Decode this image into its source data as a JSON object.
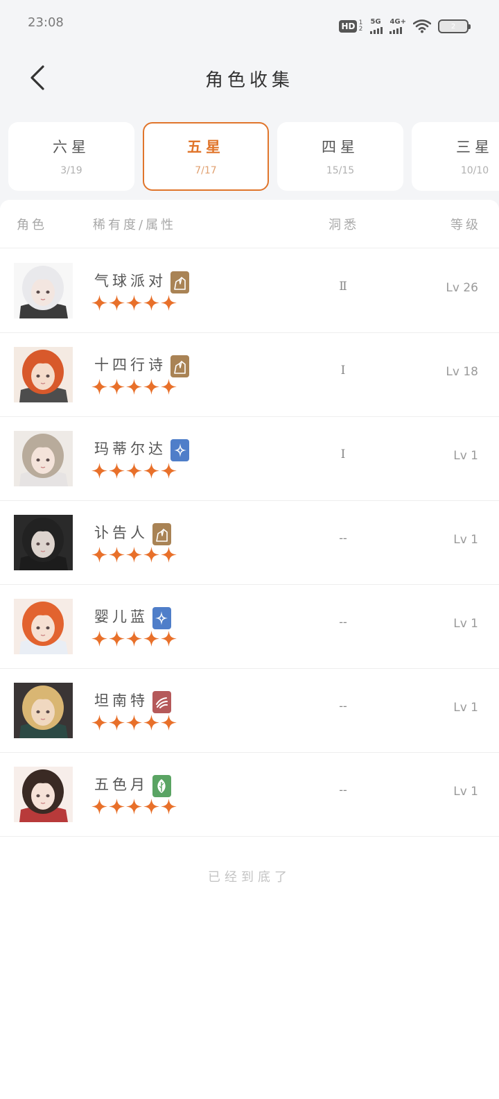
{
  "status_bar": {
    "time": "23:08",
    "hd": "HD",
    "hd_sub": "1 2",
    "signal1": "5G",
    "signal2": "4G+",
    "battery": "2"
  },
  "header": {
    "title": "角色收集"
  },
  "tabs": [
    {
      "label": "六星",
      "count": "3/19",
      "active": false
    },
    {
      "label": "五星",
      "count": "7/17",
      "active": true
    },
    {
      "label": "四星",
      "count": "15/15",
      "active": false
    },
    {
      "label": "三星",
      "count": "10/10",
      "active": false
    }
  ],
  "table": {
    "headers": {
      "character": "角色",
      "rarity_attr": "稀有度/属性",
      "insight": "洞悉",
      "level": "等级"
    },
    "rows": [
      {
        "name": "气球派对",
        "attr": "rock-icon",
        "attr_color": "#a98355",
        "insight": "Ⅱ",
        "level": "Lv 26",
        "stars": 5,
        "avatar": {
          "hair": "#e9e9ec",
          "skin": "#f3e6e0",
          "bg": "#f7f7f7",
          "cloth": "#3b3b3b"
        }
      },
      {
        "name": "十四行诗",
        "attr": "rock-icon",
        "attr_color": "#a98355",
        "insight": "Ⅰ",
        "level": "Lv 18",
        "stars": 5,
        "avatar": {
          "hair": "#d8592b",
          "skin": "#f5dccb",
          "bg": "#f4eae2",
          "cloth": "#4d4d4d"
        }
      },
      {
        "name": "玛蒂尔达",
        "attr": "star-icon",
        "attr_color": "#4f7ec9",
        "insight": "Ⅰ",
        "level": "Lv 1",
        "stars": 5,
        "avatar": {
          "hair": "#b8ab9b",
          "skin": "#f4e3da",
          "bg": "#eeeae6",
          "cloth": "#e6e3e3"
        }
      },
      {
        "name": "讣告人",
        "attr": "rock-icon",
        "attr_color": "#a98355",
        "insight": "--",
        "level": "Lv 1",
        "stars": 5,
        "avatar": {
          "hair": "#222222",
          "skin": "#ddd4ce",
          "bg": "#2a2a2a",
          "cloth": "#1c1c1c"
        }
      },
      {
        "name": "婴儿蓝",
        "attr": "star-icon",
        "attr_color": "#4f7ec9",
        "insight": "--",
        "level": "Lv 1",
        "stars": 5,
        "avatar": {
          "hair": "#e2632f",
          "skin": "#f6e0d2",
          "bg": "#f6ece6",
          "cloth": "#e9eef5"
        }
      },
      {
        "name": "坦南特",
        "attr": "beast-icon",
        "attr_color": "#b5595a",
        "insight": "--",
        "level": "Lv 1",
        "stars": 5,
        "avatar": {
          "hair": "#d9b673",
          "skin": "#f0d8c0",
          "bg": "#3a3535",
          "cloth": "#2c4a45"
        }
      },
      {
        "name": "五色月",
        "attr": "plant-icon",
        "attr_color": "#5aa463",
        "insight": "--",
        "level": "Lv 1",
        "stars": 5,
        "avatar": {
          "hair": "#3a2a24",
          "skin": "#f6e2d8",
          "bg": "#f7eeea",
          "cloth": "#b83a3a"
        }
      }
    ]
  },
  "footer": {
    "end_text": "已经到底了"
  },
  "colors": {
    "accent": "#e0752b",
    "star": "#e8702a"
  }
}
